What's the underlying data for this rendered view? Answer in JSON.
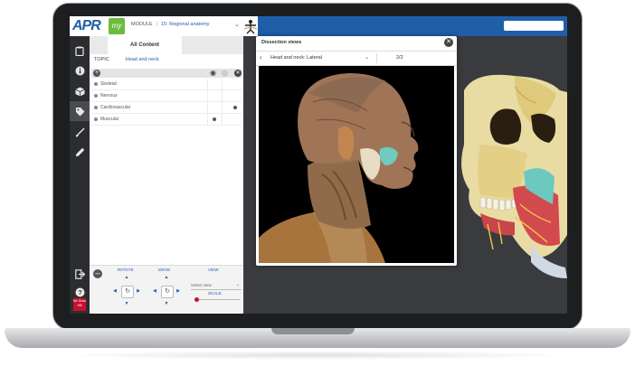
{
  "header": {
    "logo_text": "APR",
    "my_badge": "my",
    "module_label": "MODULE",
    "module_value": "15: Regional anatomy"
  },
  "rail": {
    "icons": [
      "clipboard-icon",
      "info-icon",
      "cube-icon",
      "tag-icon",
      "brush-icon",
      "pencil-icon"
    ],
    "bottom_icons": [
      "exit-icon",
      "help-icon"
    ],
    "publisher_logo": "Mc Graw Hill"
  },
  "panel": {
    "tab_label": "All Content",
    "topic_label": "TOPIC",
    "topic_value": "Head and neck",
    "rows": [
      {
        "label": "Skeletal",
        "mark1": false,
        "mark2": false
      },
      {
        "label": "Nervous",
        "mark1": false,
        "mark2": false
      },
      {
        "label": "Cardiovascular",
        "mark1": false,
        "mark2": true
      },
      {
        "label": "Muscular",
        "mark1": true,
        "mark2": false
      }
    ]
  },
  "controls": {
    "rotate_label": "ROTATE",
    "move_label": "MOVE",
    "view_label": "VIEW",
    "view_select": "Select view",
    "scale_label": "SCALE",
    "scale_value": 0.05
  },
  "dialog": {
    "title": "Dissection views",
    "view_name": "Head and neck: Lateral",
    "page_indicator": "2/2"
  },
  "colors": {
    "brand_blue": "#1f5fa8",
    "my_green": "#6dbb3d",
    "publisher_red": "#c8102e",
    "viewer_bg": "#3a3b3e"
  }
}
